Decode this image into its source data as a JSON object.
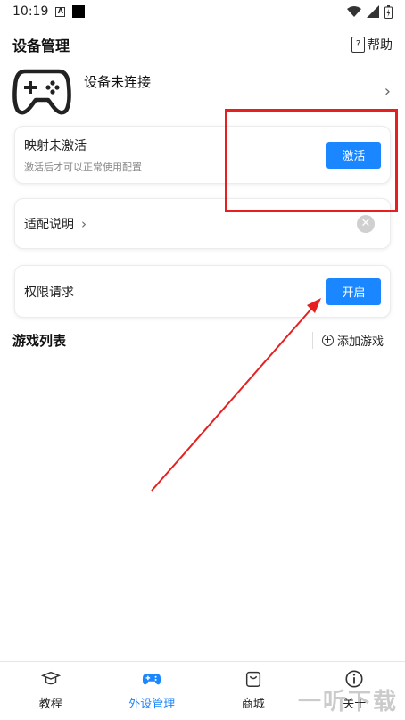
{
  "status_bar": {
    "time": "10:19"
  },
  "header": {
    "title": "设备管理",
    "help_label": "帮助",
    "help_glyph": "?"
  },
  "device": {
    "status": "设备未连接"
  },
  "activate_card": {
    "title": "映射未激活",
    "subtitle": "激活后才可以正常使用配置",
    "button": "激活"
  },
  "adapt_card": {
    "title": "适配说明"
  },
  "permission_card": {
    "title": "权限请求",
    "button": "开启"
  },
  "game_list": {
    "title": "游戏列表",
    "add_label": "添加游戏"
  },
  "tabs": [
    {
      "label": "教程",
      "icon": "graduation-cap-icon"
    },
    {
      "label": "外设管理",
      "icon": "gamepad-icon",
      "active": true
    },
    {
      "label": "商城",
      "icon": "shopping-bag-icon"
    },
    {
      "label": "关于",
      "icon": "info-icon"
    }
  ],
  "watermark": "一听下载",
  "colors": {
    "accent": "#1a86ff",
    "annotation_red": "#e62020"
  }
}
